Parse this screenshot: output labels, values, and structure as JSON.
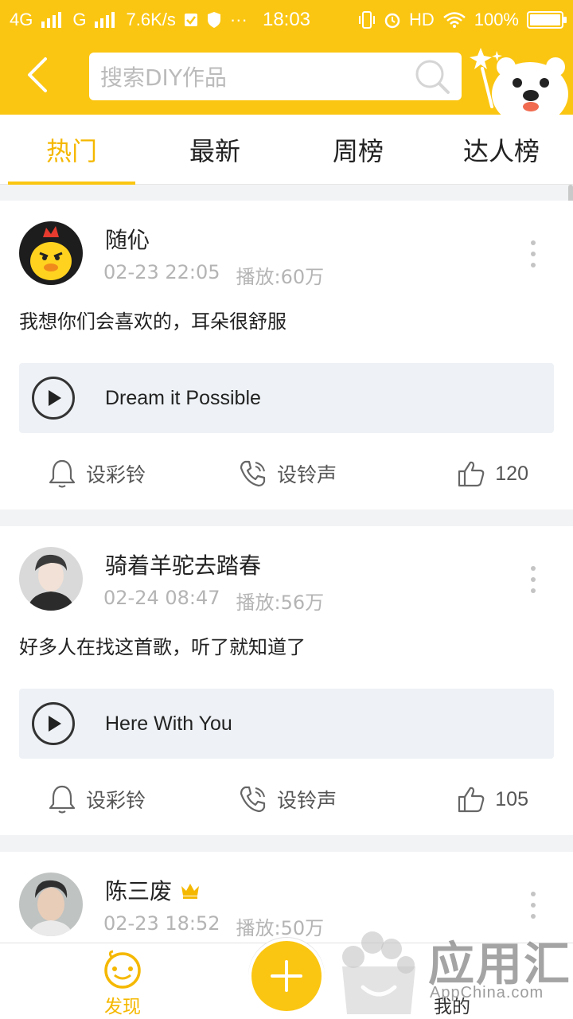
{
  "status_bar": {
    "network": "4G",
    "network2": "G",
    "speed": "7.6K/s",
    "time": "18:03",
    "hd": "HD",
    "battery": "100%"
  },
  "header": {
    "search_placeholder": "搜索DIY作品",
    "accent": "#fbc612"
  },
  "tabs": [
    {
      "label": "热门",
      "active": true
    },
    {
      "label": "最新",
      "active": false
    },
    {
      "label": "周榜",
      "active": false
    },
    {
      "label": "达人榜",
      "active": false
    }
  ],
  "posts": [
    {
      "user": "随伈",
      "date": "02-23 22:05",
      "plays": "播放:60万",
      "text": "我想你们会喜欢的，耳朵很舒服",
      "song": "Dream it Possible",
      "set_ringback": "设彩铃",
      "set_ringtone": "设铃声",
      "likes": "120"
    },
    {
      "user": "骑着羊驼去踏春",
      "date": "02-24 08:47",
      "plays": "播放:56万",
      "text": "好多人在找这首歌，听了就知道了",
      "song": "Here With You",
      "set_ringback": "设彩铃",
      "set_ringtone": "设铃声",
      "likes": "105"
    },
    {
      "user": "陈三废",
      "date": "02-23 18:52",
      "plays": "播放:50万"
    }
  ],
  "bottom_nav": {
    "discover": "发现",
    "mine": "我的"
  },
  "watermark": {
    "text": "应用汇",
    "sub": "AppChina.com"
  }
}
